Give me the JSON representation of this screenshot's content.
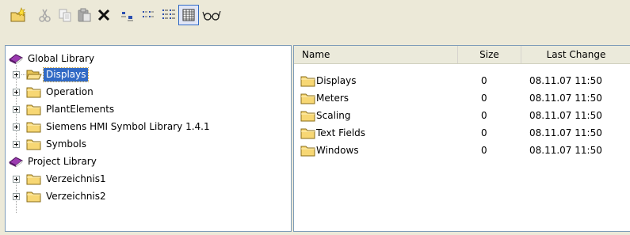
{
  "toolbar": {
    "buttons": [
      {
        "icon": "new-folder-icon"
      },
      {
        "icon": "cut-icon"
      },
      {
        "icon": "copy-icon"
      },
      {
        "icon": "paste-icon"
      },
      {
        "icon": "delete-icon"
      },
      {
        "icon": "large-icons-view-icon"
      },
      {
        "icon": "small-icons-view-icon"
      },
      {
        "icon": "list-view-icon"
      },
      {
        "icon": "details-view-icon"
      },
      {
        "icon": "preview-glasses-icon"
      }
    ]
  },
  "tree": {
    "items": [
      {
        "label": "Global Library",
        "type": "library",
        "level": 0
      },
      {
        "label": "Displays",
        "type": "folder",
        "level": 1,
        "selected": true,
        "open": true
      },
      {
        "label": "Operation",
        "type": "folder",
        "level": 1
      },
      {
        "label": "PlantElements",
        "type": "folder",
        "level": 1
      },
      {
        "label": "Siemens HMI Symbol Library 1.4.1",
        "type": "folder",
        "level": 1
      },
      {
        "label": "Symbols",
        "type": "folder",
        "level": 1
      },
      {
        "label": "Project Library",
        "type": "library",
        "level": 0
      },
      {
        "label": "Verzeichnis1",
        "type": "folder",
        "level": 1
      },
      {
        "label": "Verzeichnis2",
        "type": "folder",
        "level": 1
      }
    ]
  },
  "list": {
    "columns": [
      "Name",
      "Size",
      "Last Change"
    ],
    "rows": [
      {
        "name": "Displays",
        "size": "0",
        "last_change": "08.11.07 11:50"
      },
      {
        "name": "Meters",
        "size": "0",
        "last_change": "08.11.07 11:50"
      },
      {
        "name": "Scaling",
        "size": "0",
        "last_change": "08.11.07 11:50"
      },
      {
        "name": "Text Fields",
        "size": "0",
        "last_change": "08.11.07 11:50"
      },
      {
        "name": "Windows",
        "size": "0",
        "last_change": "08.11.07 11:50"
      }
    ]
  },
  "colors": {
    "selection": "#316ac5",
    "folder": "#f7d774",
    "library": "#7a2a8c"
  }
}
